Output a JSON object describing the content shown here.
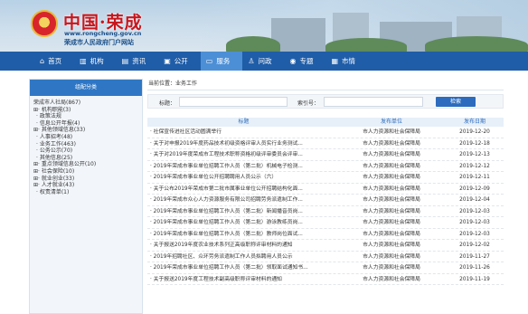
{
  "header": {
    "title": "中国·荣成",
    "url": "www.rongcheng.gov.cn",
    "subtitle": "荣成市人民政府门户网站",
    "emblem_icon": "national-emblem"
  },
  "nav": [
    {
      "label": "首页",
      "icon": "home-icon",
      "glyph": "⌂"
    },
    {
      "label": "机构",
      "icon": "institution-icon",
      "glyph": "▥"
    },
    {
      "label": "资讯",
      "icon": "news-icon",
      "glyph": "▤"
    },
    {
      "label": "公开",
      "icon": "disclosure-icon",
      "glyph": "▣"
    },
    {
      "label": "服务",
      "icon": "service-icon",
      "glyph": "▭"
    },
    {
      "label": "问政",
      "icon": "consult-icon",
      "glyph": "♙"
    },
    {
      "label": "专题",
      "icon": "topic-icon",
      "glyph": "◉"
    },
    {
      "label": "市情",
      "icon": "city-info-icon",
      "glyph": "▦"
    }
  ],
  "sidebar": {
    "title": "组配分类",
    "tree": [
      {
        "label": "荣成市人社局(867)",
        "level": 0
      },
      {
        "label": "⊞· 机构职能(3)",
        "level": 0
      },
      {
        "label": "· 政策法规",
        "level": 1
      },
      {
        "label": "· 信息公开年报(4)",
        "level": 1
      },
      {
        "label": "⊞· 其他领域信息(33)",
        "level": 0
      },
      {
        "label": "· 人事招考(48)",
        "level": 1
      },
      {
        "label": "· 业务工作(463)",
        "level": 1
      },
      {
        "label": "· 公务公示(70)",
        "level": 1
      },
      {
        "label": "· 其他信息(25)",
        "level": 1
      },
      {
        "label": "⊞· 重点领域信息公开(10)",
        "level": 0
      },
      {
        "label": "⊞· 社会保险(10)",
        "level": 0
      },
      {
        "label": "⊞· 就业创业(33)",
        "level": 0
      },
      {
        "label": "⊞· 人才就业(43)",
        "level": 0
      },
      {
        "label": "· 权责清单(1)",
        "level": 1
      }
    ]
  },
  "breadcrumb": "当前位置：业务工作",
  "search": {
    "title_label": "标题：",
    "title_value": "",
    "index_label": "索引号：",
    "index_value": "",
    "button_label": "检索"
  },
  "table": {
    "headers": [
      "标题",
      "发布单位",
      "发布日期"
    ],
    "rows": [
      {
        "title": "· 社保宣传进社区活动圆满举行",
        "unit": "市人力资源和社会保障局",
        "date": "2019-12-20"
      },
      {
        "title": "· 关于对申报2019年度药品技术初级资格评审人员实行业务测试...",
        "unit": "市人力资源和社会保障局",
        "date": "2019-12-18"
      },
      {
        "title": "· 关于对2019年度荣成市工程技术职称资格初级评审委员会评审...",
        "unit": "市人力资源和社会保障局",
        "date": "2019-12-13"
      },
      {
        "title": "· 2019年荣成市事业单位招聘工作人员（第二批）机械电子检测...",
        "unit": "市人力资源和社会保障局",
        "date": "2019-12-12"
      },
      {
        "title": "· 2019年荣成市事业单位公开招聘聘用人员公示（六）",
        "unit": "市人力资源和社会保障局",
        "date": "2019-12-11"
      },
      {
        "title": "· 关于公布2019年荣成市第二批市属事业单位公开招聘结构化面...",
        "unit": "市人力资源和社会保障局",
        "date": "2019-12-09"
      },
      {
        "title": "· 2019年荣成市众心人力资源服务有限公司招聘劳务派遣制工作...",
        "unit": "市人力资源和社会保障局",
        "date": "2019-12-04"
      },
      {
        "title": "· 2019年荣成市事业单位招聘工作人员（第二批）新闻播音员岗...",
        "unit": "市人力资源和社会保障局",
        "date": "2019-12-03"
      },
      {
        "title": "· 2019年荣成市事业单位招聘工作人员（第二批）游泳教练员岗...",
        "unit": "市人力资源和社会保障局",
        "date": "2019-12-03"
      },
      {
        "title": "· 2019年荣成市事业单位招聘工作人员（第二批）教师岗位面试...",
        "unit": "市人力资源和社会保障局",
        "date": "2019-12-03"
      },
      {
        "title": "· 关于报送2019年度农业技术系列正高级职称评审材料的通知",
        "unit": "市人力资源和社会保障局",
        "date": "2019-12-02"
      },
      {
        "title": "· 2019年招聘社区、众环劳务派遣制工作人员拟聘用人员公示",
        "unit": "市人力资源和社会保障局",
        "date": "2019-11-27"
      },
      {
        "title": "· 2019年荣成市事业单位招聘工作人员（第二批）领取面试通知书...",
        "unit": "市人力资源和社会保障局",
        "date": "2019-11-26"
      },
      {
        "title": "· 关于报送2019年度工程技术副高级职称评审材料的通知",
        "unit": "市人力资源和社会保障局",
        "date": "2019-11-19"
      }
    ]
  },
  "colors": {
    "nav": "#1f5da8",
    "nav_active": "#4d8fd6",
    "accent": "#2c6bbd",
    "title_red": "#c8161d"
  }
}
